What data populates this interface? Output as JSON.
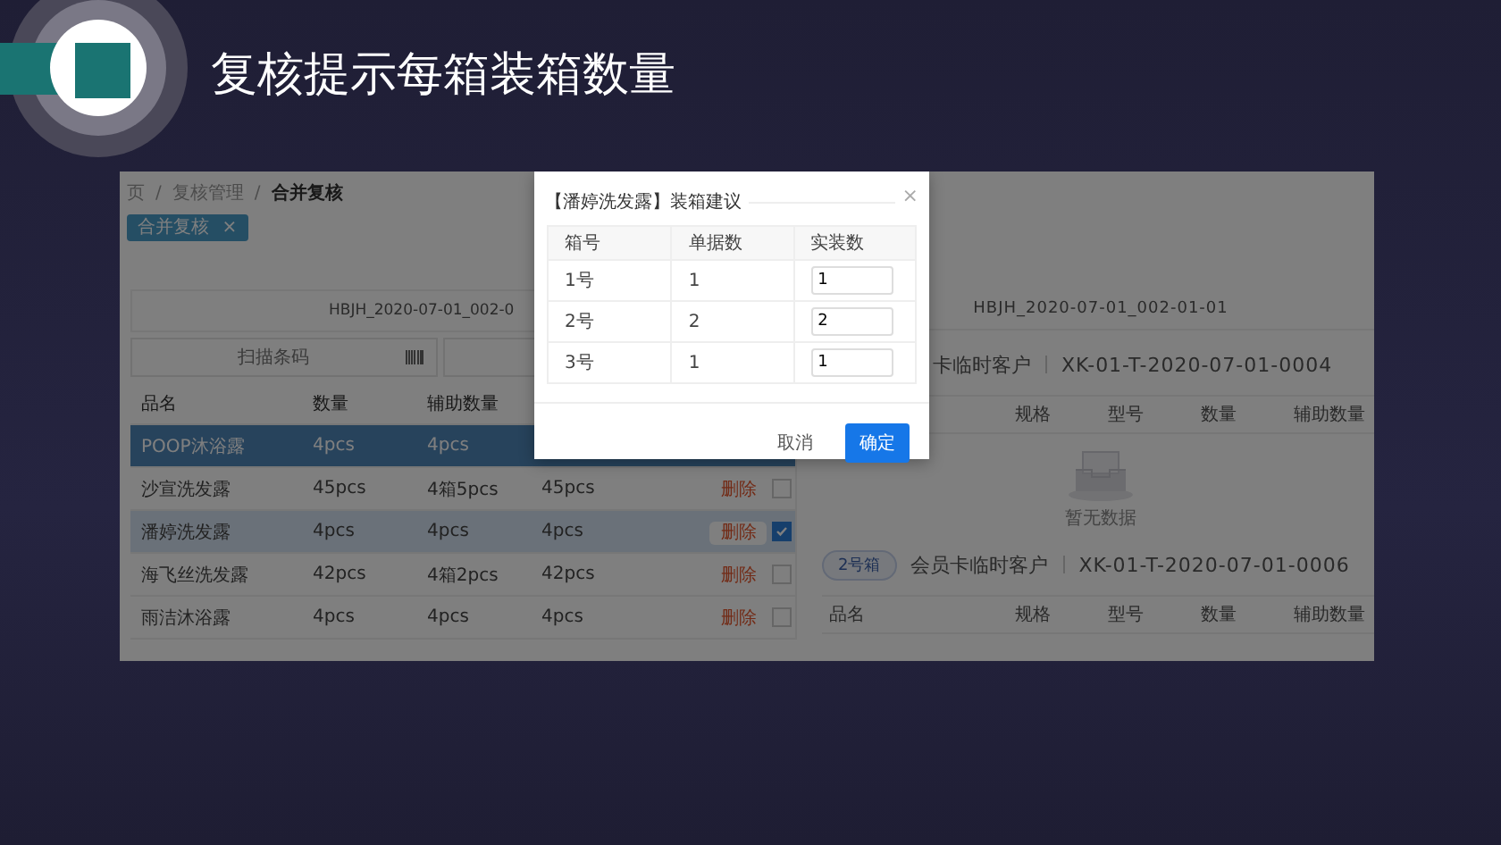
{
  "slide": {
    "title": "复核提示每箱装箱数量"
  },
  "app": {
    "breadcrumb": [
      "页",
      "复核管理",
      "合并复核"
    ],
    "breadcrumb_separator": "/",
    "tag": {
      "label": "合并复核",
      "close": "×"
    },
    "left": {
      "order": "HBJH_2020-07-01_002-0",
      "scan_placeholder": "扫描条码",
      "columns": [
        "品名",
        "数量",
        "辅助数量"
      ],
      "rows": [
        {
          "cells": [
            "POOP沐浴露",
            "4pcs",
            "4pcs"
          ],
          "selected": true
        },
        {
          "cells": [
            "沙宣洗发露",
            "45pcs",
            "4箱5pcs",
            "45pcs"
          ],
          "action": "删除",
          "checked": false,
          "selected": false
        },
        {
          "cells": [
            "潘婷洗发露",
            "4pcs",
            "4pcs",
            "4pcs"
          ],
          "action": "删除",
          "checked": true,
          "selected": true
        },
        {
          "cells": [
            "海飞丝洗发露",
            "42pcs",
            "4箱2pcs",
            "42pcs"
          ],
          "action": "删除",
          "checked": false,
          "selected": false
        },
        {
          "cells": [
            "雨洁沐浴露",
            "4pcs",
            "4pcs",
            "4pcs"
          ],
          "action": "删除",
          "checked": false,
          "selected": false
        }
      ]
    },
    "right": {
      "order": "HBJH_2020-07-01_002-01-01",
      "boxes": [
        {
          "customer": "卡临时客户",
          "code": "XK-01-T-2020-07-01-0004",
          "columns": [
            "",
            "规格",
            "型号",
            "数量",
            "辅助数量"
          ],
          "empty": "暂无数据"
        },
        {
          "badge": "2号箱",
          "customer": "会员卡临时客户",
          "code": "XK-01-T-2020-07-01-0006",
          "columns": [
            "品名",
            "规格",
            "型号",
            "数量",
            "辅助数量"
          ]
        }
      ]
    }
  },
  "dialog": {
    "title": "【潘婷洗发露】装箱建议",
    "close": "×",
    "columns": [
      "箱号",
      "单据数",
      "实装数"
    ],
    "rows": [
      {
        "box": "1号",
        "count": "1",
        "value": "1"
      },
      {
        "box": "2号",
        "count": "2",
        "value": "2"
      },
      {
        "box": "3号",
        "count": "1",
        "value": "1"
      }
    ],
    "buttons": [
      {
        "label": "取消",
        "kind": "text"
      },
      {
        "label": "确定",
        "kind": "primary"
      }
    ]
  }
}
